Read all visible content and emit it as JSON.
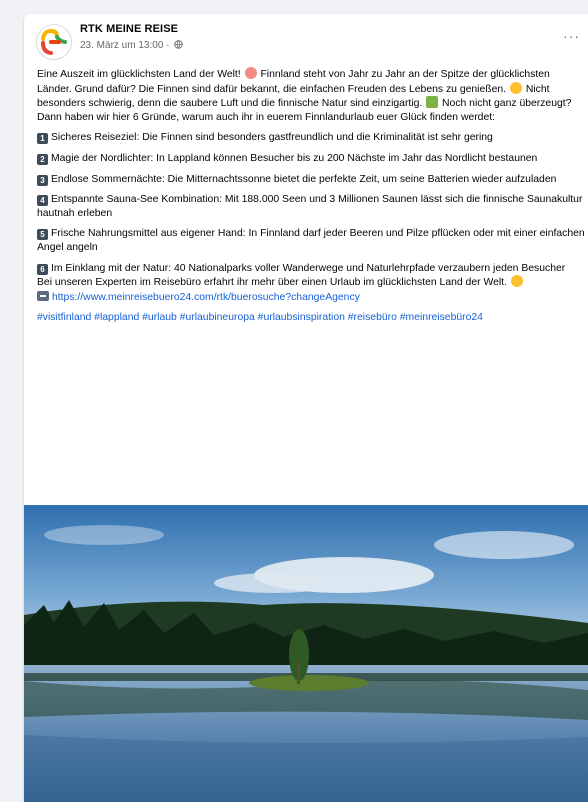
{
  "post": {
    "page_name": "RTK MEINE REISE",
    "date": "23. März um 13:00 ·",
    "more": "···",
    "intro": [
      "Eine Auszeit im glücklichsten Land der Welt! ",
      " Finnland steht von Jahr zu Jahr an der Spitze der glücklichsten Länder. Grund dafür? Die Finnen sind dafür bekannt, die einfachen Freuden des Lebens zu genießen. ",
      " Nicht besonders schwierig, denn die saubere Luft und die finnische Natur sind einzigartig. ",
      " Noch nicht ganz überzeugt? Dann haben wir hier 6 Gründe, warum auch ihr in euerem Finnlandurlaub euer Glück finden werdet:"
    ],
    "reasons": [
      {
        "num": "1",
        "text": "Sicheres Reiseziel: Die Finnen sind besonders gastfreundlich und die Kriminalität ist sehr gering"
      },
      {
        "num": "2",
        "text": "Magie der Nordlichter: In Lappland können Besucher bis zu 200 Nächste im Jahr das Nordlicht bestaunen"
      },
      {
        "num": "3",
        "text": "Endlose Sommernächte: Die Mitternachtssonne bietet die perfekte Zeit, um seine Batterien wieder aufzuladen"
      },
      {
        "num": "4",
        "text": "Entspannte Sauna-See Kombination: Mit 188.000 Seen und 3 Millionen Saunen lässt sich die finnische Saunakultur hautnah erleben"
      },
      {
        "num": "5",
        "text": "Frische Nahrungsmittel aus eigener Hand: In Finnland darf jeder Beeren und Pilze pflücken oder mit einer einfachen Angel angeln"
      },
      {
        "num": "6",
        "text": "Im Einklang mit der Natur: 40 Nationalparks voller Wanderwege und Naturlehrpfade verzaubern jeden Besucher"
      }
    ],
    "closing": "Bei unseren Experten im Reisebüro erfahrt ihr mehr über einen Urlaub im glücklichsten Land der Welt. ",
    "link": "https://www.meinreisebuero24.com/rtk/buerosuche?changeAgency",
    "hashtags": "#visitfinland #lappland #urlaub #urlaubineuropa #urlaubsinspiration #reisebüro #meinreisebüro24",
    "colors": {
      "link": "#1660d6",
      "secondary_text": "#65676b",
      "background": "#f0f2f5"
    },
    "icons": {
      "globe": "globe-icon",
      "more": "more-options-icon",
      "link": "link-arrow-icon"
    }
  }
}
